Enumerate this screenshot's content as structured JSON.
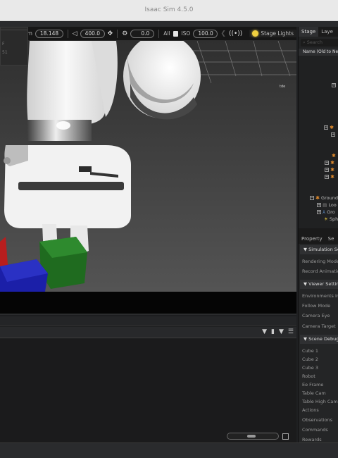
{
  "window": {
    "title": "Isaac Sim 4.5.0"
  },
  "viewport": {
    "dropdown_items": [
      "F",
      "51"
    ],
    "toolbar": {
      "zoom_label": "om",
      "zoom_value": "18.148",
      "speed_value": "400.0",
      "exposure_value": "0.0",
      "all_label": "All",
      "iso_label": "ISO",
      "iso_value": "100.0",
      "stage_lights_label": "Stage Lights"
    },
    "overlay_tag": "tde"
  },
  "stage_panel": {
    "tabs": [
      "Stage",
      "Laye"
    ],
    "search_placeholder": "Search",
    "column_header": "Name (Old to New)",
    "tree_items": [
      "Ground",
      "Loo",
      "Gro",
      "Sph"
    ]
  },
  "property_panel": {
    "tabs": [
      "Property",
      "Se"
    ],
    "sections": [
      {
        "title": "Simulation Se",
        "rows": [
          "Rendering Mode",
          "Record Animation"
        ]
      },
      {
        "title": "Viewer Settin",
        "rows": [
          "Environments Inde",
          "Follow Mode",
          "Camera Eye",
          "Camera Target"
        ]
      },
      {
        "title": "Scene Debug",
        "rows": [
          "Cube 1",
          "Cube 2",
          "Cube 3",
          "Robot",
          "Ee Frame",
          "Table Cam",
          "Table High Cam",
          "Actions",
          "Observations",
          "Commands",
          "Rewards"
        ]
      }
    ]
  }
}
